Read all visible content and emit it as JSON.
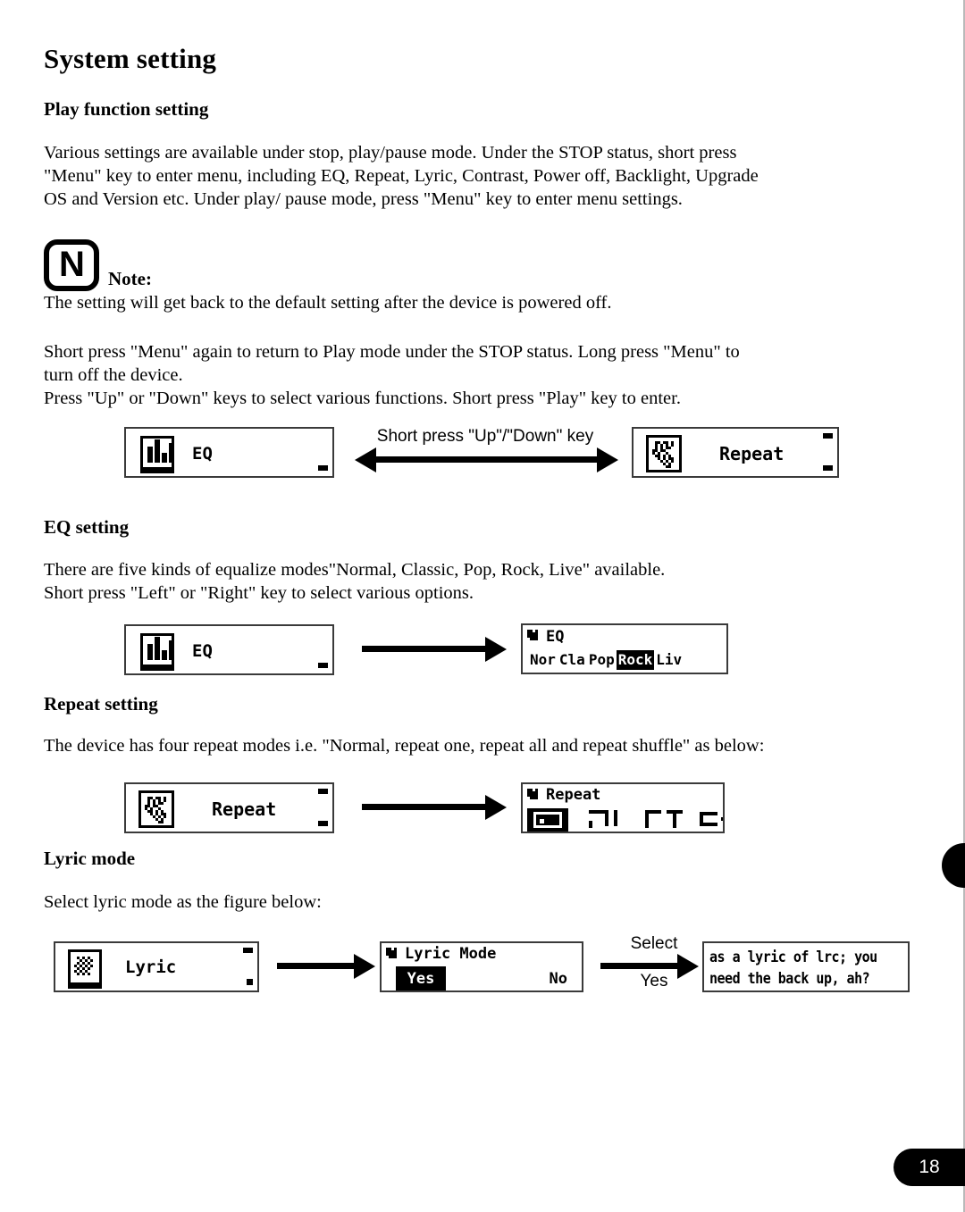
{
  "document": {
    "title": "System setting",
    "page_number": "18"
  },
  "sections": {
    "play_function": {
      "heading": "Play function setting",
      "body": "Various settings are available under stop, play/pause mode. Under the STOP status, short press\n\"Menu\" key to enter menu, including EQ, Repeat, Lyric, Contrast, Power off, Backlight, Upgrade\nOS and Version etc. Under play/ pause mode, press \"Menu\" key to enter menu settings."
    },
    "note": {
      "icon_letter": "N",
      "label": "Note:",
      "body": "The setting will get back to the default setting after the device is powered off."
    },
    "keys_info": {
      "body": "Short press \"Menu\" again to return to Play mode under the STOP status. Long press \"Menu\" to\nturn off the device.\nPress \"Up\" or \"Down\" keys to select various functions. Short press \"Play\" key to enter."
    },
    "eq": {
      "heading": "EQ setting",
      "body": "There are five kinds of equalize modes\"Normal, Classic, Pop, Rock, Live\" available.\nShort press \"Left\" or \"Right\" key to select various options."
    },
    "repeat": {
      "heading": "Repeat setting",
      "body": "The device has four repeat modes i.e. \"Normal, repeat one, repeat all and repeat shuffle\" as below:"
    },
    "lyric": {
      "heading": "Lyric mode",
      "body": "Select lyric mode as the figure below:"
    }
  },
  "figures": {
    "menu_nav": {
      "caption": "Short press \"Up\"/\"Down\" key",
      "left_screen": {
        "icon": "equalizer-icon",
        "label": "EQ"
      },
      "right_screen": {
        "icon": "repeat-icon",
        "label": "Repeat"
      }
    },
    "eq_flow": {
      "source_screen": {
        "icon": "equalizer-icon",
        "label": "EQ"
      },
      "result_screen": {
        "title": "EQ",
        "options": [
          "Nor",
          "Cla",
          "Pop",
          "Rock",
          "Liv"
        ],
        "selected": "Rock"
      }
    },
    "repeat_flow": {
      "source_screen": {
        "icon": "repeat-icon",
        "label": "Repeat"
      },
      "result_screen": {
        "title": "Repeat",
        "options": [
          "normal-icon",
          "repeat-one-icon",
          "repeat-all-icon",
          "shuffle-icon"
        ],
        "selected_index": 0
      }
    },
    "lyric_flow": {
      "source_screen": {
        "icon": "lyric-icon",
        "label": "Lyric"
      },
      "mode_screen": {
        "title": "Lyric Mode",
        "options": [
          "Yes",
          "No"
        ],
        "selected": "Yes"
      },
      "arrow_caption_top": "Select",
      "arrow_caption_bottom": "Yes",
      "result_screen": {
        "line1": "as a lyric of lrc; you",
        "line2": "need the back up, ah?"
      }
    }
  }
}
